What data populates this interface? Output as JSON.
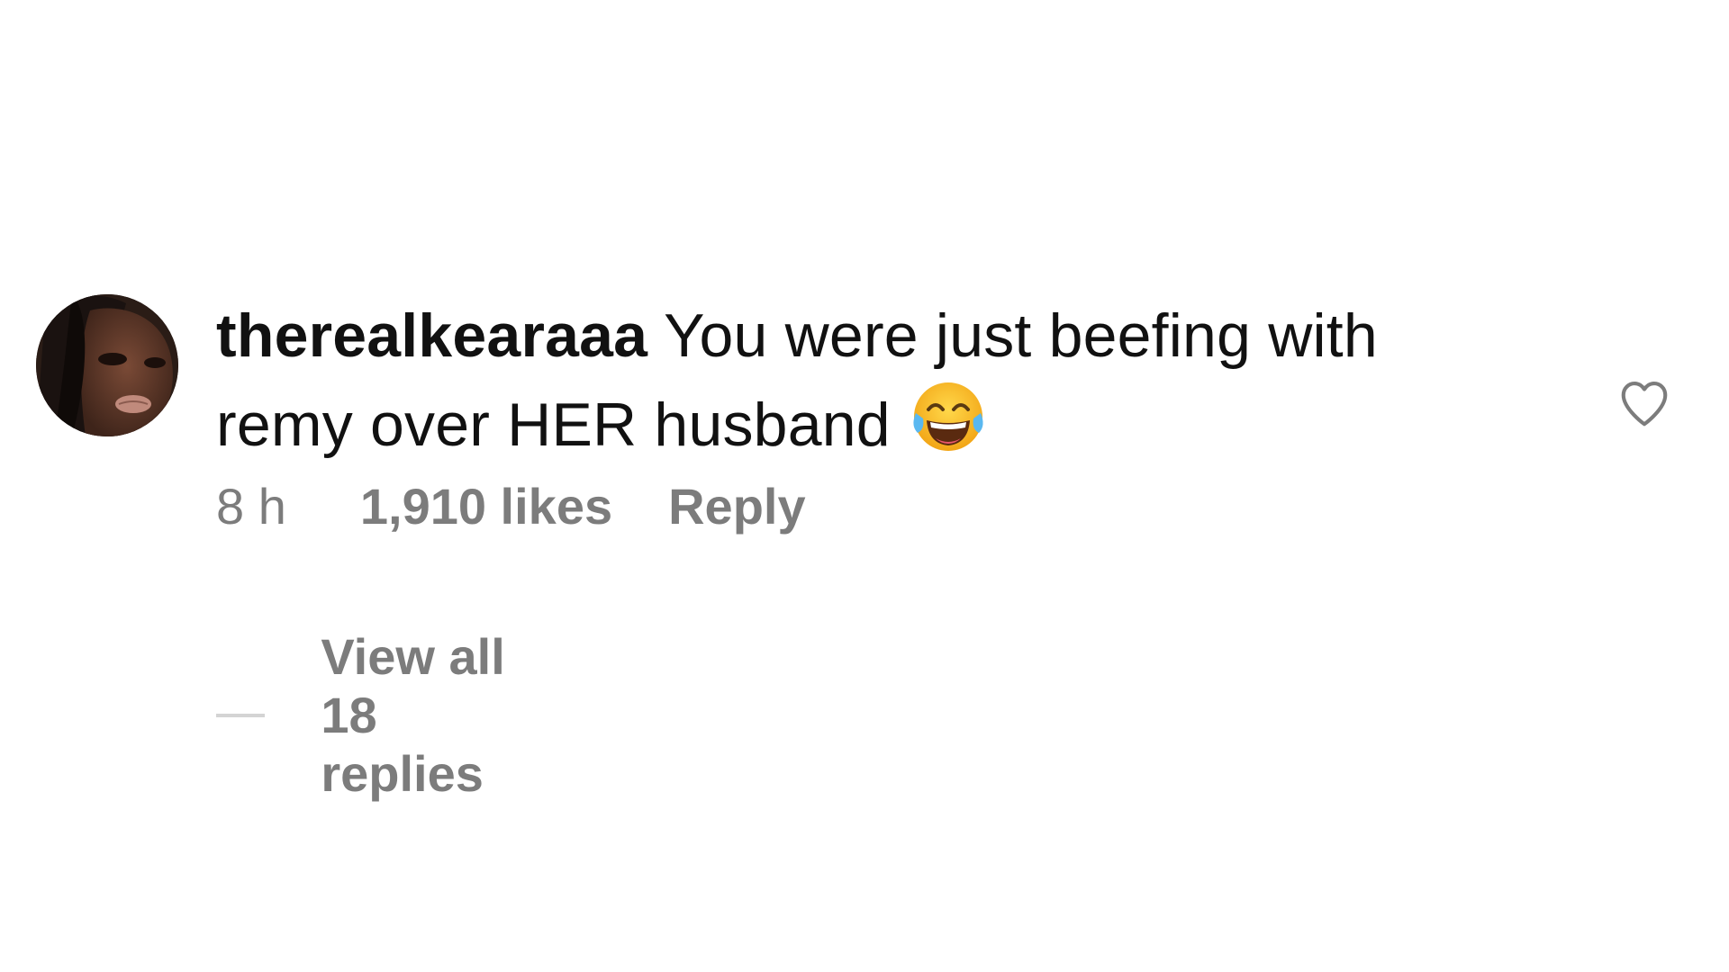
{
  "comment": {
    "username": "therealkearaaa",
    "text": "You were just beefing with remy over HER husband",
    "emoji": "face-with-tears-of-joy",
    "time": "8 h",
    "likes": "1,910 likes",
    "reply_label": "Reply",
    "view_replies_label": "View all 18 replies"
  },
  "icons": {
    "like": "heart-outline-icon"
  },
  "colors": {
    "text": "#111111",
    "muted": "#7c7c7c",
    "divider": "#d4d4d4"
  }
}
